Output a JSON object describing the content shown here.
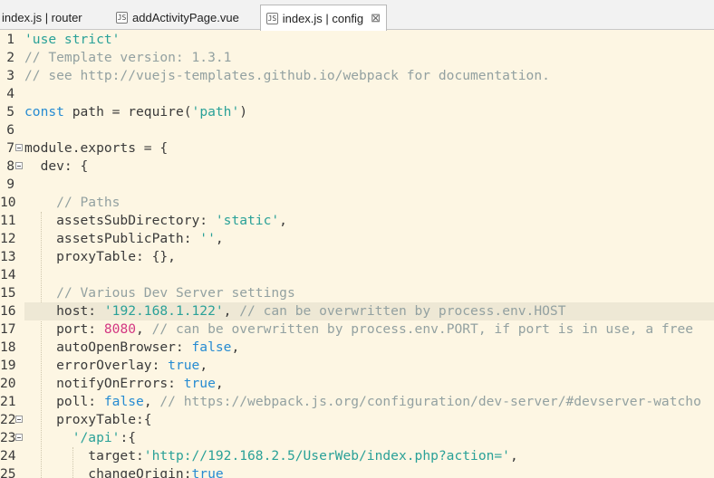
{
  "tabs": [
    {
      "label": "index.js | router",
      "icon": "js-file-icon",
      "active": false
    },
    {
      "label": "addActivityPage.vue",
      "icon": "vue-file-icon",
      "active": false
    },
    {
      "label": "index.js | config",
      "icon": "js-file-icon",
      "active": true
    }
  ],
  "tab_icon_glyph": "JS",
  "close_glyph": "⊠",
  "colors": {
    "background": "#fdf6e3",
    "current_line": "#eee8d5",
    "text": "#3a3a3a",
    "string": "#2aa198",
    "comment": "#93a1a1",
    "keyword": "#268bd2",
    "number": "#d33682"
  },
  "highlighted_line": 16,
  "lines": [
    {
      "n": "1",
      "tokens": [
        {
          "t": "'use strict'",
          "c": "str"
        }
      ]
    },
    {
      "n": "2",
      "tokens": [
        {
          "t": "// Template version: 1.3.1",
          "c": "cmt"
        }
      ]
    },
    {
      "n": "3",
      "tokens": [
        {
          "t": "// see http://vuejs-templates.github.io/webpack for documentation.",
          "c": "cmt"
        }
      ]
    },
    {
      "n": "4",
      "tokens": []
    },
    {
      "n": "5",
      "tokens": [
        {
          "t": "const",
          "c": "kw"
        },
        {
          "t": " path = require(",
          "c": "txt"
        },
        {
          "t": "'path'",
          "c": "str"
        },
        {
          "t": ")",
          "c": "txt"
        }
      ]
    },
    {
      "n": "6",
      "tokens": []
    },
    {
      "n": "7",
      "fold": true,
      "tokens": [
        {
          "t": "module.exports = {",
          "c": "txt"
        }
      ]
    },
    {
      "n": "8",
      "fold": true,
      "tokens": [
        {
          "t": "  dev: {",
          "c": "txt"
        }
      ]
    },
    {
      "n": "9",
      "tokens": []
    },
    {
      "n": "10",
      "tokens": [
        {
          "t": "    ",
          "c": "txt"
        },
        {
          "t": "// Paths",
          "c": "cmt"
        }
      ]
    },
    {
      "n": "11",
      "tokens": [
        {
          "t": "    assetsSubDirectory: ",
          "c": "txt"
        },
        {
          "t": "'static'",
          "c": "str"
        },
        {
          "t": ",",
          "c": "txt"
        }
      ]
    },
    {
      "n": "12",
      "tokens": [
        {
          "t": "    assetsPublicPath: ",
          "c": "txt"
        },
        {
          "t": "''",
          "c": "str"
        },
        {
          "t": ",",
          "c": "txt"
        }
      ]
    },
    {
      "n": "13",
      "tokens": [
        {
          "t": "    proxyTable: {},",
          "c": "txt"
        }
      ]
    },
    {
      "n": "14",
      "tokens": []
    },
    {
      "n": "15",
      "tokens": [
        {
          "t": "    ",
          "c": "txt"
        },
        {
          "t": "// Various Dev Server settings",
          "c": "cmt"
        }
      ]
    },
    {
      "n": "16",
      "tokens": [
        {
          "t": "    host: ",
          "c": "txt"
        },
        {
          "t": "'192.168.1.122'",
          "c": "str"
        },
        {
          "t": ", ",
          "c": "txt"
        },
        {
          "t": "// can be overwritten by process.env.HOST",
          "c": "cmt"
        }
      ]
    },
    {
      "n": "17",
      "tokens": [
        {
          "t": "    port: ",
          "c": "txt"
        },
        {
          "t": "8080",
          "c": "num"
        },
        {
          "t": ", ",
          "c": "txt"
        },
        {
          "t": "// can be overwritten by process.env.PORT, if port is in use, a free",
          "c": "cmt"
        }
      ]
    },
    {
      "n": "18",
      "tokens": [
        {
          "t": "    autoOpenBrowser: ",
          "c": "txt"
        },
        {
          "t": "false",
          "c": "kw"
        },
        {
          "t": ",",
          "c": "txt"
        }
      ]
    },
    {
      "n": "19",
      "tokens": [
        {
          "t": "    errorOverlay: ",
          "c": "txt"
        },
        {
          "t": "true",
          "c": "kw"
        },
        {
          "t": ",",
          "c": "txt"
        }
      ]
    },
    {
      "n": "20",
      "tokens": [
        {
          "t": "    notifyOnErrors: ",
          "c": "txt"
        },
        {
          "t": "true",
          "c": "kw"
        },
        {
          "t": ",",
          "c": "txt"
        }
      ]
    },
    {
      "n": "21",
      "tokens": [
        {
          "t": "    poll: ",
          "c": "txt"
        },
        {
          "t": "false",
          "c": "kw"
        },
        {
          "t": ", ",
          "c": "txt"
        },
        {
          "t": "// https://webpack.js.org/configuration/dev-server/#devserver-watcho",
          "c": "cmt"
        }
      ]
    },
    {
      "n": "22",
      "fold": true,
      "tokens": [
        {
          "t": "    proxyTable:{",
          "c": "txt"
        }
      ]
    },
    {
      "n": "23",
      "fold": true,
      "tokens": [
        {
          "t": "      ",
          "c": "txt"
        },
        {
          "t": "'/api'",
          "c": "str"
        },
        {
          "t": ":{",
          "c": "txt"
        }
      ]
    },
    {
      "n": "24",
      "tokens": [
        {
          "t": "        target:",
          "c": "txt"
        },
        {
          "t": "'http://192.168.2.5/UserWeb/index.php?action='",
          "c": "str"
        },
        {
          "t": ",",
          "c": "txt"
        }
      ]
    },
    {
      "n": "25",
      "tokens": [
        {
          "t": "        changeOrigin:",
          "c": "txt"
        },
        {
          "t": "true",
          "c": "kw"
        }
      ]
    }
  ]
}
